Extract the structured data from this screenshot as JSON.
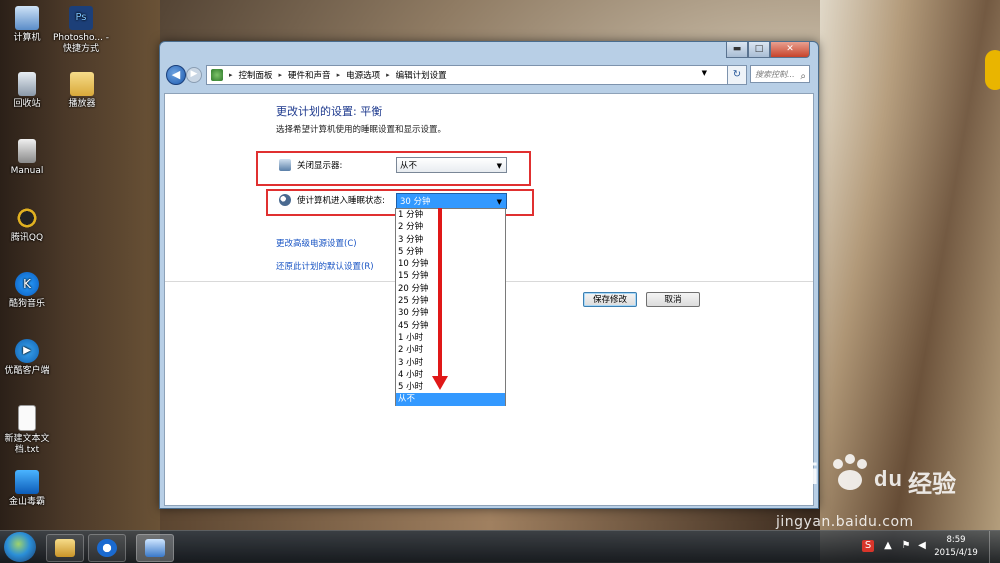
{
  "desktop": {
    "icons": [
      {
        "label": "计算机",
        "name": "computer-icon"
      },
      {
        "label": "Photosho... - 快捷方式",
        "name": "photoshop-icon"
      },
      {
        "label": "回收站",
        "name": "recycle-bin-icon"
      },
      {
        "label": "播放器",
        "name": "player-folder-icon"
      },
      {
        "label": "Manual",
        "name": "manual-icon"
      },
      {
        "label": "腾讯QQ",
        "name": "qq-icon"
      },
      {
        "label": "酷狗音乐",
        "name": "kugou-icon"
      },
      {
        "label": "优酷客户端",
        "name": "youku-icon"
      },
      {
        "label": "新建文本文档.txt",
        "name": "text-file-icon"
      },
      {
        "label": "金山毒霸",
        "name": "duba-icon"
      }
    ]
  },
  "window": {
    "controls": {
      "minimize": "▬",
      "maximize": "□",
      "close": "✕"
    },
    "breadcrumbs": [
      "控制面板",
      "硬件和声音",
      "电源选项",
      "编辑计划设置"
    ],
    "search_placeholder": "搜索控制...",
    "refresh_glyph": "↻",
    "back_glyph": "◀",
    "forward_glyph": "▶"
  },
  "page": {
    "title": "更改计划的设置: 平衡",
    "subtitle": "选择希望计算机使用的睡眠设置和显示设置。",
    "display_off_label": "关闭显示器:",
    "display_off_value": "从不",
    "sleep_label": "使计算机进入睡眠状态:",
    "sleep_value": "30 分钟",
    "advanced_link": "更改高级电源设置(C)",
    "restore_link": "还原此计划的默认设置(R)",
    "save_button": "保存修改",
    "cancel_button": "取消"
  },
  "sleep_options": [
    "1 分钟",
    "2 分钟",
    "3 分钟",
    "5 分钟",
    "10 分钟",
    "15 分钟",
    "20 分钟",
    "25 分钟",
    "30 分钟",
    "45 分钟",
    "1 小时",
    "2 小时",
    "3 小时",
    "4 小时",
    "5 小时",
    "从不"
  ],
  "sleep_options_highlighted": "从不",
  "taskbar": {
    "time": "8:59",
    "date": "2015/4/19"
  },
  "watermark": {
    "logo": "Bai",
    "logo_suffix": "du",
    "cn": "经验",
    "url": "jingyan.baidu.com"
  },
  "colors": {
    "highlight": "#3399ff",
    "annotation_red": "#e01818",
    "link": "#1a55c4",
    "heading": "#1e3a8e"
  }
}
